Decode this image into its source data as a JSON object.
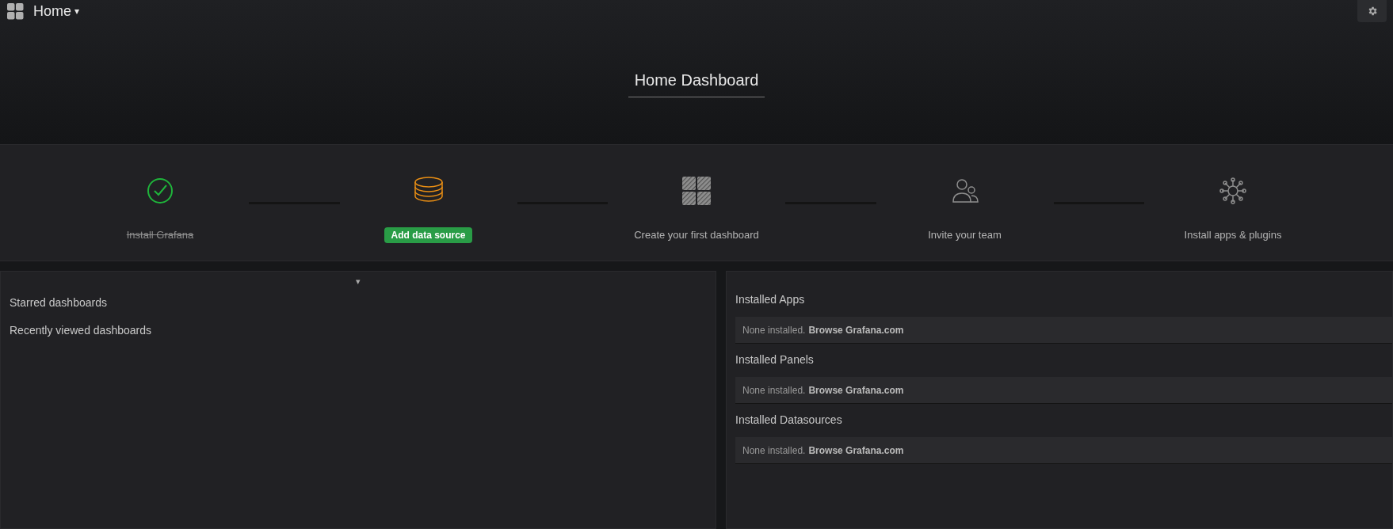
{
  "topbar": {
    "title": "Home",
    "caret": "▾"
  },
  "header": {
    "title": "Home Dashboard"
  },
  "steps": [
    {
      "kind": "done",
      "label": "Install Grafana"
    },
    {
      "kind": "active",
      "label": "Add data source"
    },
    {
      "kind": "todo",
      "label": "Create your first dashboard"
    },
    {
      "kind": "todo",
      "label": "Invite your team"
    },
    {
      "kind": "todo",
      "label": "Install apps & plugins"
    }
  ],
  "dashboards": {
    "caret": "▾",
    "sections": [
      "Starred dashboards",
      "Recently viewed dashboards"
    ]
  },
  "plugins": [
    {
      "title": "Installed Apps",
      "text": "None installed.",
      "link": "Browse Grafana.com"
    },
    {
      "title": "Installed Panels",
      "text": "None installed.",
      "link": "Browse Grafana.com"
    },
    {
      "title": "Installed Datasources",
      "text": "None installed.",
      "link": "Browse Grafana.com"
    }
  ]
}
